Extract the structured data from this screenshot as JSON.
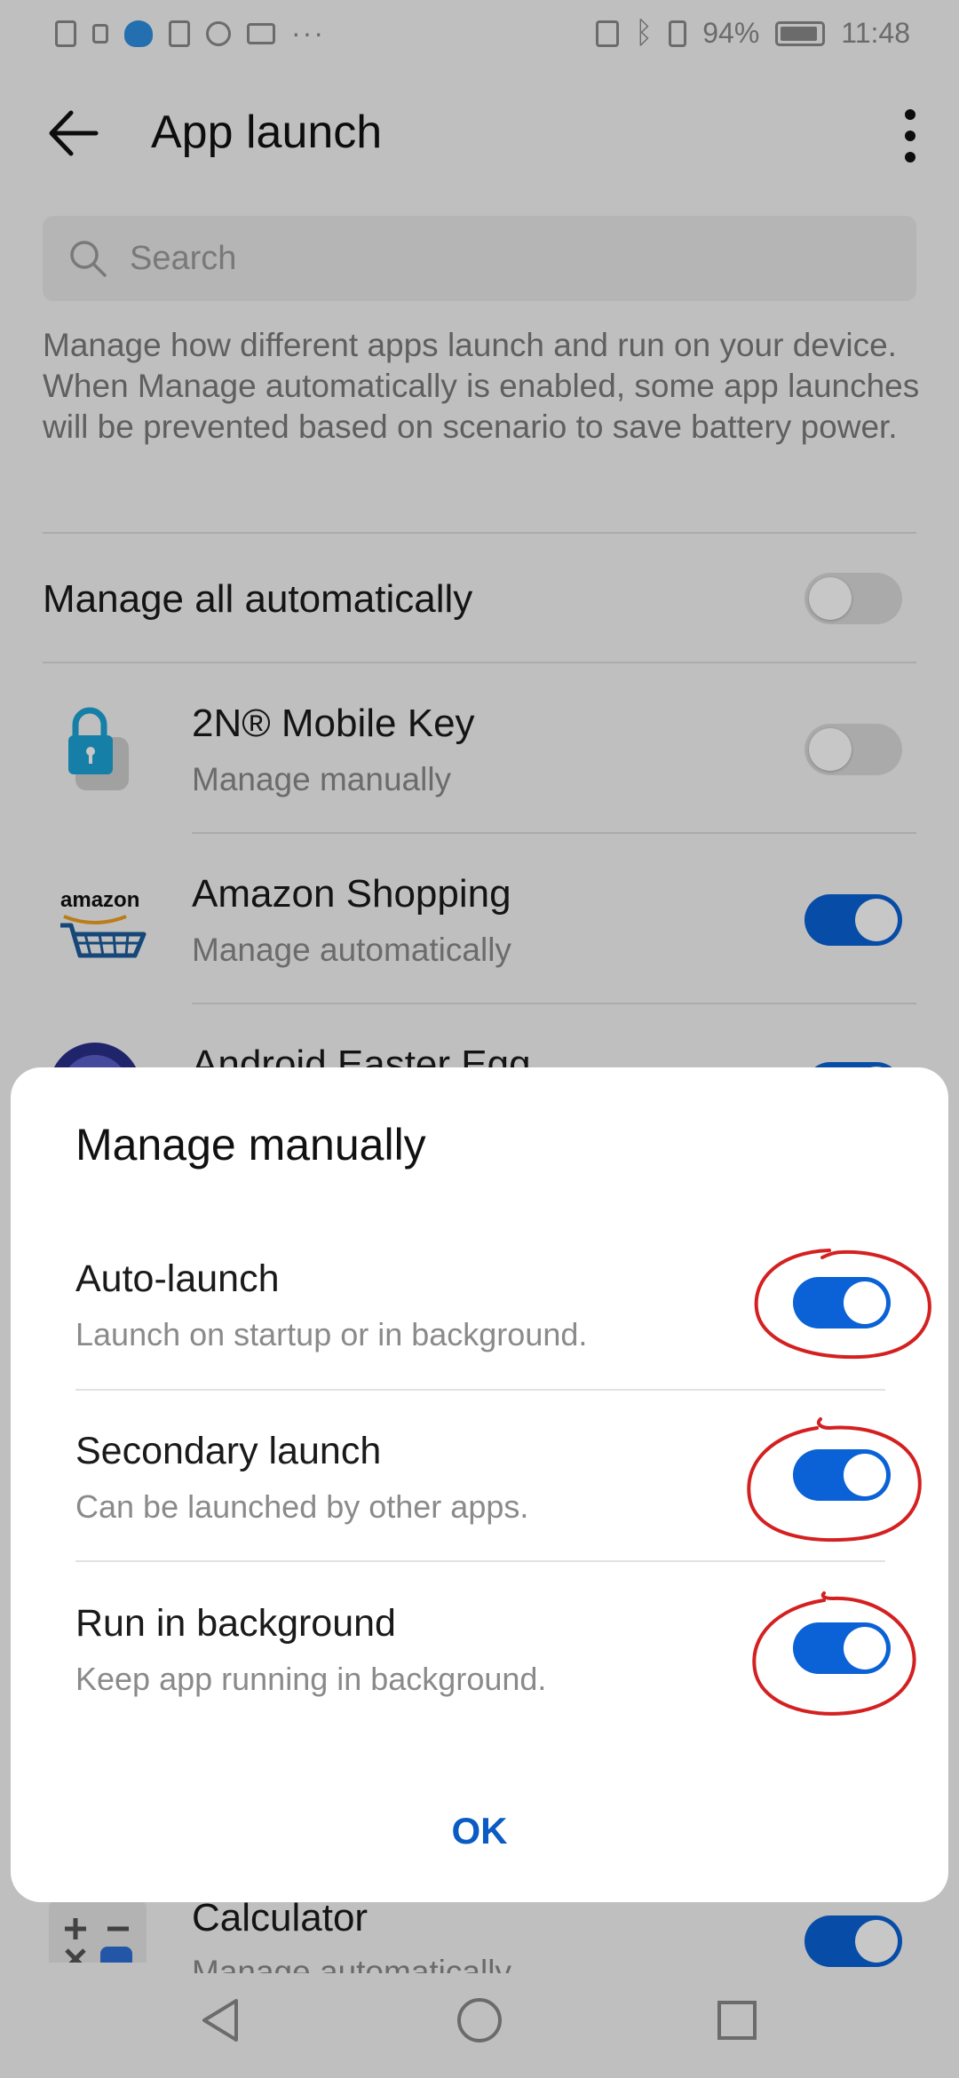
{
  "status_bar": {
    "battery": "94%",
    "time": "11:48",
    "icons_left": [
      "alert-icon",
      "lock-icon",
      "heart-icon",
      "upload-icon",
      "settings-icon",
      "mail-icon",
      "more-dots"
    ],
    "icons_right": [
      "nfc-icon",
      "bluetooth-icon",
      "vibrate-icon",
      "battery-icon"
    ]
  },
  "toolbar": {
    "title": "App launch"
  },
  "search": {
    "placeholder": "Search"
  },
  "description": "Manage how different apps launch and run on your device. When Manage automatically is enabled, some app launches will be prevented based on scenario to save battery power.",
  "manage_all": {
    "label": "Manage all automatically",
    "enabled": false
  },
  "apps": [
    {
      "name": "2N® Mobile Key",
      "status": "Manage manually",
      "enabled": false
    },
    {
      "name": "Amazon Shopping",
      "status": "Manage automatically",
      "enabled": true,
      "logo_text": "amazon"
    },
    {
      "name": "Android Easter Egg",
      "status": "",
      "enabled": true
    },
    {
      "name": "Calculator",
      "status": "Manage automatically",
      "enabled": true
    }
  ],
  "dialog": {
    "title": "Manage manually",
    "options": [
      {
        "label": "Auto-launch",
        "description": "Launch on startup or in background.",
        "enabled": true
      },
      {
        "label": "Secondary launch",
        "description": "Can be launched by other apps.",
        "enabled": true
      },
      {
        "label": "Run in background",
        "description": "Keep app running in background.",
        "enabled": true
      }
    ],
    "ok_label": "OK"
  },
  "colors": {
    "accent": "#0a62d6",
    "annotation": "#d42020",
    "dialog_bg": "#ffffff",
    "page_bg": "#f5f5f5"
  }
}
